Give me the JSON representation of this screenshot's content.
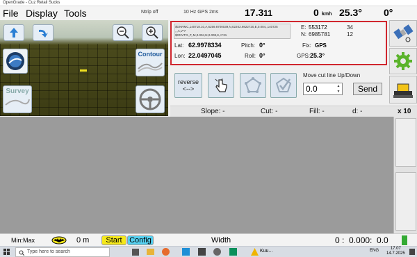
{
  "window": {
    "title": "OpenGrade - Cuz Retail Sucks"
  },
  "menu": {
    "file": "File",
    "display": "Display",
    "tools": "Tools"
  },
  "topbar": {
    "ntrip": "Ntrip off",
    "gps_rate": "10 Hz GPS 2ms",
    "heading_value": "17.3",
    "heading_suffix": "11",
    "speed_value": "0",
    "speed_unit": "kmh",
    "temp_value": "25.3°",
    "angle_value": "0°"
  },
  "view3d": {
    "contour_label": "Contour",
    "survey_label": "Survey"
  },
  "gps": {
    "nmea_line1": "$GNRMC,140718.10,A,6259.8700039,N,02202.9822720,E,0.004,,140725",
    "nmea_line2": ",,,A,V*7",
    "nmea_line3": "$GNVTG,,T,,M,0.004,N,0.008,K,A*31",
    "east_label": "E:",
    "east_value": "553172",
    "east_num": "34",
    "north_label": "N:",
    "north_value": "6985781",
    "north_num": "12",
    "lat_label": "Lat:",
    "lat_value": "62.9978334",
    "lon_label": "Lon:",
    "lon_value": "22.0497045",
    "pitch_label": "Pitch:",
    "pitch_value": "0°",
    "roll_label": "Roll:",
    "roll_value": "0°",
    "fix_label": "Fix:",
    "fix_value": "GPS",
    "gps_temp_label": "GPS:",
    "gps_temp_value": "25.3°"
  },
  "tools": {
    "reverse_label": "reverse\n<-->",
    "move_cut_label": "Move cut line Up/Down",
    "move_cut_value": "0.0",
    "send_label": "Send"
  },
  "status": {
    "slope": "Slope: -",
    "cut": "Cut: -",
    "fill": "Fill: -",
    "d": "d: -",
    "zoom": "x 10"
  },
  "bottom": {
    "minmax": "Min:Max",
    "distance": "0 m",
    "start": "Start",
    "config": "Config",
    "width": "Width",
    "readout": "0 :  0.000:  0.0"
  },
  "taskbar": {
    "search_placeholder": "Type here to search",
    "weather": "Kuu...",
    "lang": "ENG",
    "time": "17.07",
    "date": "14.7.2025"
  },
  "colors": {
    "highlight": "#d0262e",
    "start_btn": "#f5e81a",
    "config_btn": "#55d0f0"
  }
}
